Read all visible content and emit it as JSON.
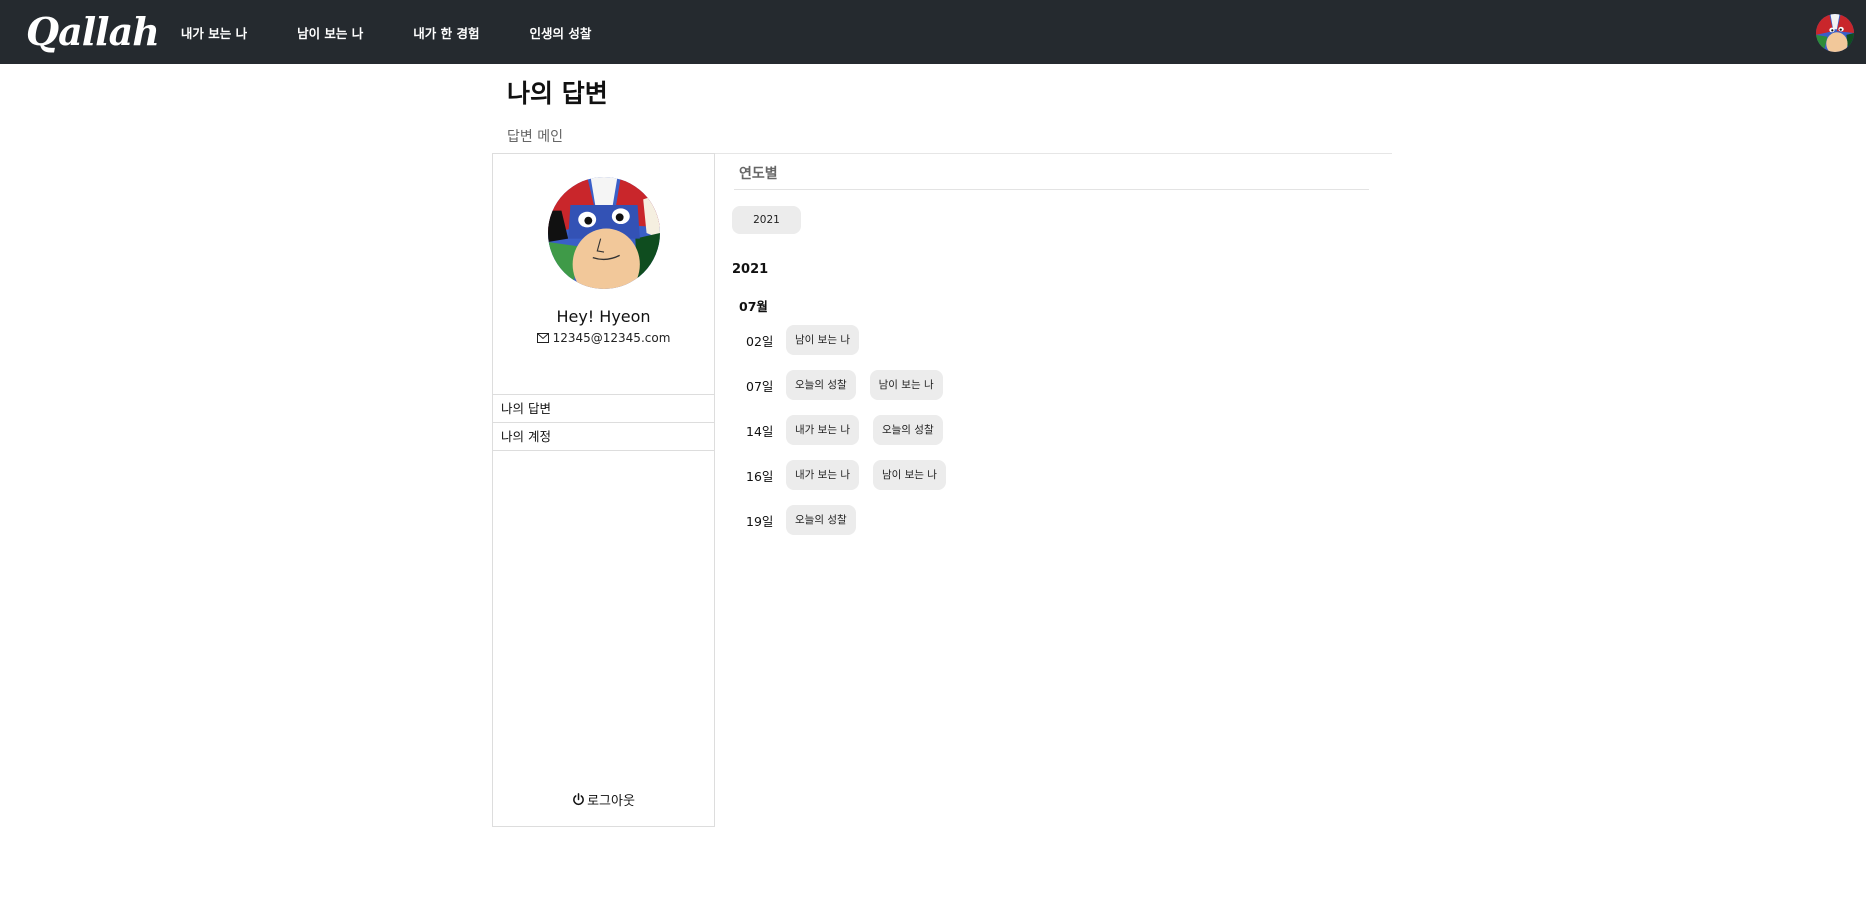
{
  "nav": {
    "brand": "Qallah",
    "links": [
      "내가 보는 나",
      "남이 보는 나",
      "내가 한 경험",
      "인생의 성찰"
    ]
  },
  "page": {
    "title": "나의 답변",
    "breadcrumb": "답변 메인"
  },
  "profile": {
    "name": "Hey! Hyeon",
    "email": "12345@12345.com"
  },
  "sidebar": {
    "items": [
      "나의 답변",
      "나의 계정"
    ],
    "logout": "로그아웃"
  },
  "filter": {
    "title": "연도별",
    "years": [
      "2021"
    ]
  },
  "answers": {
    "year": "2021",
    "month": "07월",
    "days": [
      {
        "day": "02일",
        "tags": [
          "남이 보는 나"
        ]
      },
      {
        "day": "07일",
        "tags": [
          "오늘의 성찰",
          "남이 보는 나"
        ]
      },
      {
        "day": "14일",
        "tags": [
          "내가 보는 나",
          "오늘의 성찰"
        ]
      },
      {
        "day": "16일",
        "tags": [
          "내가 보는 나",
          "남이 보는 나"
        ]
      },
      {
        "day": "19일",
        "tags": [
          "오늘의 성찰"
        ]
      }
    ]
  },
  "colors": {
    "navbar": "#252a2f",
    "chip": "#ececec",
    "border": "#dddddd"
  },
  "icons": {
    "email": "envelope-icon",
    "logout": "power-icon"
  }
}
